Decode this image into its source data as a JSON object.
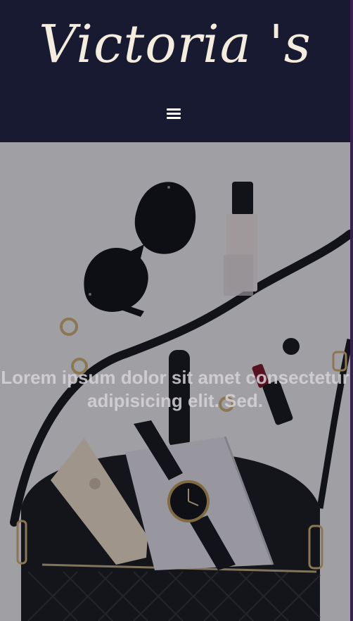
{
  "brand": {
    "logo_text": "Victoria 's"
  },
  "nav": {
    "menu_icon": "hamburger-menu-icon"
  },
  "hero": {
    "headline": "Lorem ipsum dolor sit amet consectetur adipisicing elit. Sed."
  },
  "colors": {
    "header_bg": "#171a31",
    "logo_text": "#f4ecdc",
    "overlay": "rgba(20,22,38,0.34)"
  }
}
